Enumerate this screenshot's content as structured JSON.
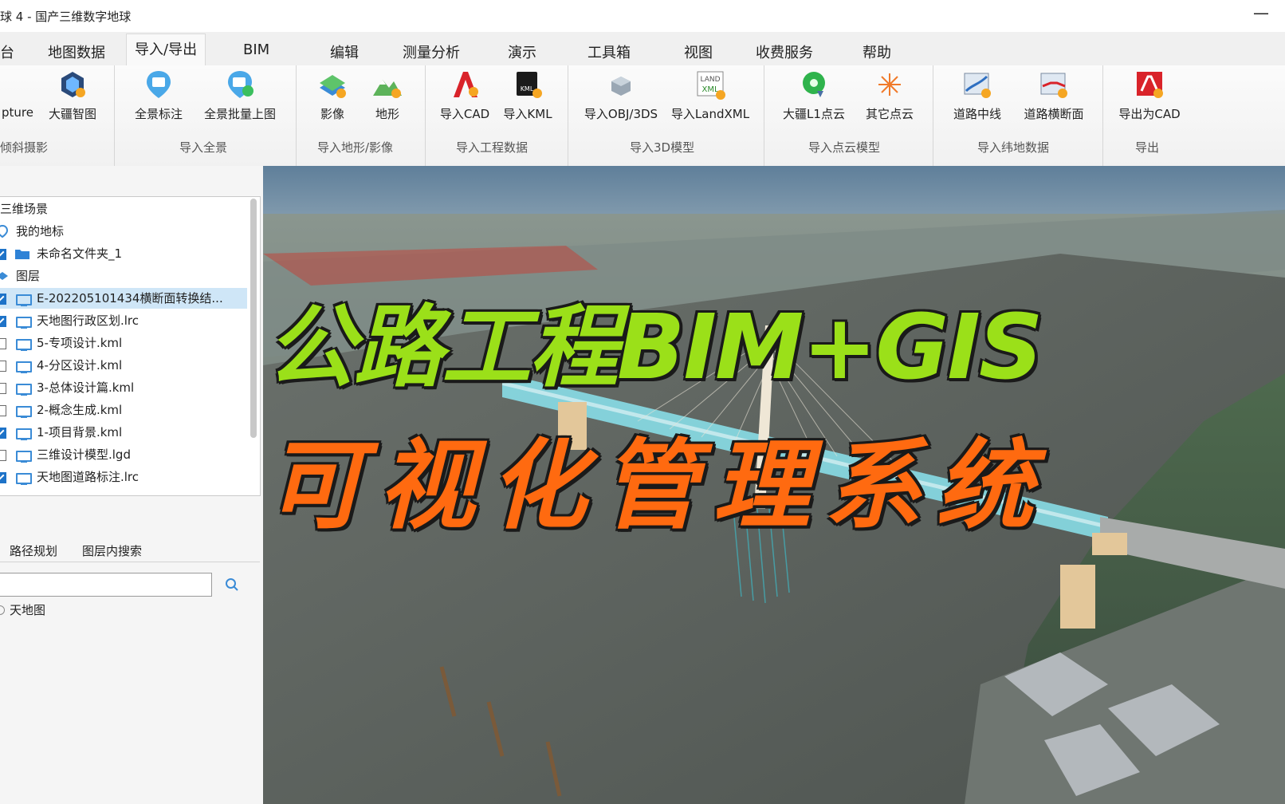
{
  "window": {
    "title": "球 4 - 国产三维数字地球",
    "minimize_glyph": "—"
  },
  "menu": {
    "items": [
      {
        "label": "台"
      },
      {
        "label": "地图数据"
      },
      {
        "label": "导入/导出",
        "active": true
      },
      {
        "label": "BIM"
      },
      {
        "label": "编辑"
      },
      {
        "label": "测量分析"
      },
      {
        "label": "演示"
      },
      {
        "label": "工具箱"
      },
      {
        "label": "视图"
      },
      {
        "label": "收费服务"
      },
      {
        "label": "帮助"
      }
    ]
  },
  "ribbon": {
    "items": [
      {
        "label": "pture",
        "icon": "capture-icon"
      },
      {
        "label": "大疆智图",
        "icon": "dji-terra-icon"
      },
      {
        "label": "全景标注",
        "icon": "panorama-mark-icon"
      },
      {
        "label": "全景批量上图",
        "icon": "panorama-batch-icon"
      },
      {
        "label": "影像",
        "icon": "imagery-icon"
      },
      {
        "label": "地形",
        "icon": "terrain-icon"
      },
      {
        "label": "导入CAD",
        "icon": "cad-icon"
      },
      {
        "label": "导入KML",
        "icon": "kml-icon"
      },
      {
        "label": "导入OBJ/3DS",
        "icon": "obj-3ds-icon"
      },
      {
        "label": "导入LandXML",
        "icon": "landxml-icon"
      },
      {
        "label": "大疆L1点云",
        "icon": "dji-l1-pointcloud-icon"
      },
      {
        "label": "其它点云",
        "icon": "other-pointcloud-icon"
      },
      {
        "label": "道路中线",
        "icon": "road-centerline-icon"
      },
      {
        "label": "道路横断面",
        "icon": "road-cross-section-icon"
      },
      {
        "label": "导出为CAD",
        "icon": "export-cad-icon"
      }
    ],
    "groups": [
      {
        "label": "倾斜摄影"
      },
      {
        "label": "导入全景"
      },
      {
        "label": "导入地形/影像"
      },
      {
        "label": "导入工程数据"
      },
      {
        "label": "导入3D模型"
      },
      {
        "label": "导入点云模型"
      },
      {
        "label": "导入纬地数据"
      },
      {
        "label": "导出"
      }
    ]
  },
  "tree": {
    "root": "三维场景",
    "rows": [
      {
        "label": "我的地标",
        "type": "landmark"
      },
      {
        "label": "未命名文件夹_1",
        "type": "folder",
        "checked": true
      },
      {
        "label": "图层",
        "type": "layer-group"
      },
      {
        "label": "E-202205101434横断面转换结...",
        "type": "item",
        "checked": true,
        "selected": true
      },
      {
        "label": "天地图行政区划.lrc",
        "type": "item",
        "checked": true
      },
      {
        "label": "5-专项设计.kml",
        "type": "item",
        "checked": false
      },
      {
        "label": "4-分区设计.kml",
        "type": "item",
        "checked": false
      },
      {
        "label": "3-总体设计篇.kml",
        "type": "item",
        "checked": false
      },
      {
        "label": "2-概念生成.kml",
        "type": "item",
        "checked": false
      },
      {
        "label": "1-项目背景.kml",
        "type": "item",
        "checked": true
      },
      {
        "label": "三维设计模型.lgd",
        "type": "item",
        "checked": false
      },
      {
        "label": "天地图道路标注.lrc",
        "type": "item",
        "checked": true
      }
    ]
  },
  "search": {
    "tabs": [
      {
        "label": "路径规划"
      },
      {
        "label": "图层内搜索"
      }
    ],
    "value": "",
    "result": "天地图"
  },
  "overlay": {
    "line1": "公路工程BIM+GIS",
    "line2": "可视化管理系统",
    "line1_color": "#9be019",
    "line2_color": "#ff6a10"
  }
}
